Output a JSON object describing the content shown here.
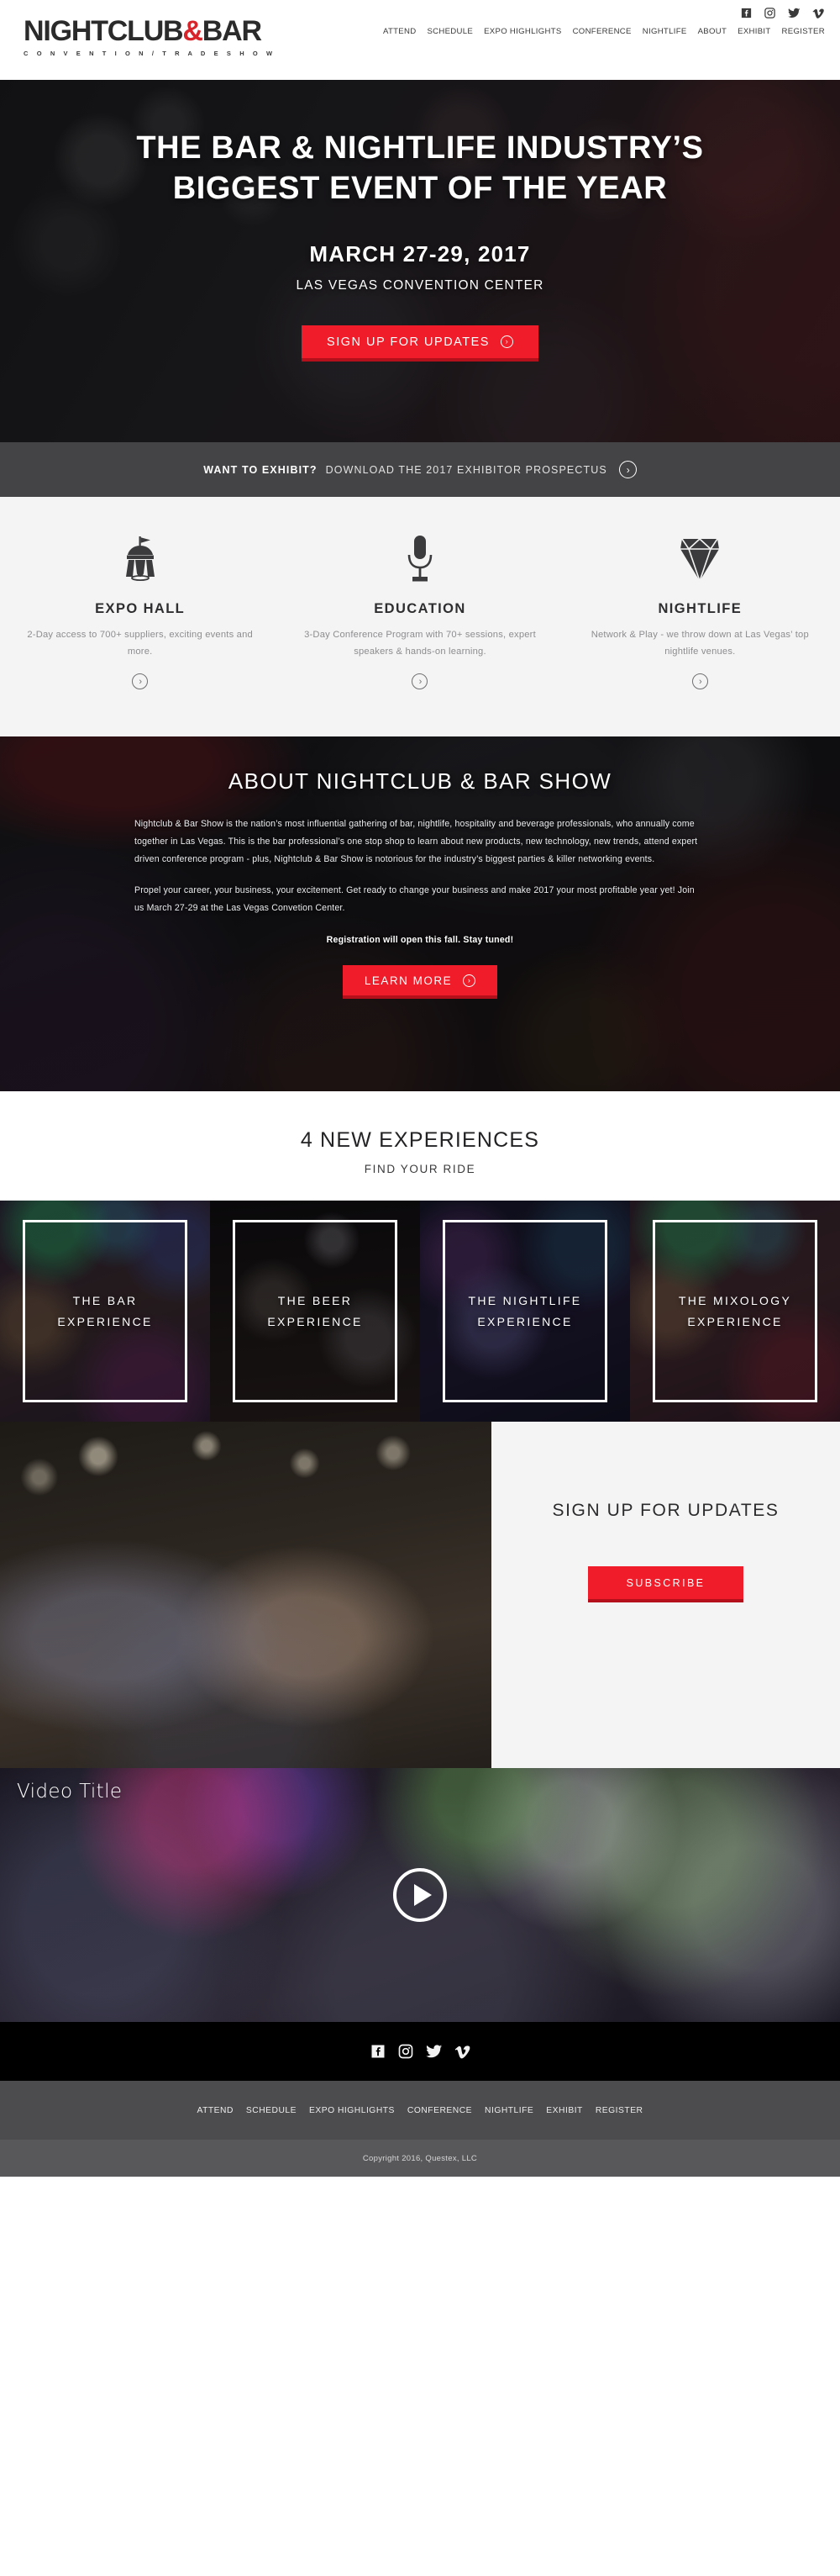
{
  "header": {
    "logo_main": "NIGHTCLUB",
    "logo_amp": "&",
    "logo_main2": "BAR",
    "logo_sub": "C O N V E N T I O N   /   T R A D E   S H O W",
    "social": [
      {
        "name": "facebook-icon",
        "label": "Facebook"
      },
      {
        "name": "instagram-icon",
        "label": "Instagram"
      },
      {
        "name": "twitter-icon",
        "label": "Twitter"
      },
      {
        "name": "vimeo-icon",
        "label": "Vimeo"
      }
    ],
    "nav": [
      {
        "label": "ATTEND"
      },
      {
        "label": "SCHEDULE"
      },
      {
        "label": "EXPO HIGHLIGHTS"
      },
      {
        "label": "CONFERENCE"
      },
      {
        "label": "NIGHTLIFE"
      },
      {
        "label": "ABOUT"
      },
      {
        "label": "EXHIBIT"
      },
      {
        "label": "REGISTER"
      }
    ]
  },
  "hero": {
    "title_line1": "THE BAR & NIGHTLIFE INDUSTRY’S",
    "title_line2": "BIGGEST EVENT OF THE YEAR",
    "date": "MARCH 27-29, 2017",
    "venue": "LAS VEGAS CONVENTION CENTER",
    "cta": "SIGN UP FOR UPDATES",
    "cta_arrow": "›",
    "accent_color": "#f01c29"
  },
  "exhibit_band": {
    "strong": "WANT TO EXHIBIT?",
    "rest": "DOWNLOAD THE 2017 EXHIBITOR PROSPECTUS",
    "arrow": "›",
    "bg_color": "#444446"
  },
  "features": [
    {
      "icon": "tent-icon",
      "title": "EXPO HALL",
      "desc": "2-Day access to 700+ suppliers, exciting events and more.",
      "arrow": "›"
    },
    {
      "icon": "microphone-icon",
      "title": "EDUCATION",
      "desc": "3-Day Conference Program with 70+ sessions, expert speakers & hands-on learning.",
      "arrow": "›"
    },
    {
      "icon": "diamond-icon",
      "title": "NIGHTLIFE",
      "desc": "Network & Play - we throw down at Las Vegas’ top nightlife venues.",
      "arrow": "›"
    }
  ],
  "about": {
    "title": "ABOUT NIGHTCLUB & BAR SHOW",
    "paragraph1": "Nightclub & Bar Show is the nation’s most influential gathering of bar, nightlife, hospitality and beverage professionals, who annually come together in Las Vegas. This is the bar professional’s one stop shop to learn about new products, new technology, new trends, attend expert driven conference program - plus, Nightclub & Bar Show is notorious for the industry’s biggest parties & killer networking events.",
    "paragraph2": "Propel your career, your business, your excitement. Get ready to change your business and make 2017 your most profitable year yet! Join us March 27-29 at the Las Vegas Convetion Center.",
    "note": "Registration will open this fall. Stay tuned!",
    "cta": "LEARN MORE",
    "cta_arrow": "›"
  },
  "experiences": {
    "title": "4 NEW EXPERIENCES",
    "subtitle": "FIND YOUR RIDE",
    "cards": [
      {
        "line1": "THE BAR",
        "line2": "EXPERIENCE"
      },
      {
        "line1": "THE BEER",
        "line2": "EXPERIENCE"
      },
      {
        "line1": "THE NIGHTLIFE",
        "line2": "EXPERIENCE"
      },
      {
        "line1": "THE MIXOLOGY",
        "line2": "EXPERIENCE"
      }
    ]
  },
  "signup": {
    "title": "SIGN UP FOR UPDATES",
    "button": "SUBSCRIBE"
  },
  "video": {
    "title": "Video Title",
    "play_label": "play-button"
  },
  "footer": {
    "social": [
      {
        "name": "facebook-icon",
        "label": "Facebook"
      },
      {
        "name": "instagram-icon",
        "label": "Instagram"
      },
      {
        "name": "twitter-icon",
        "label": "Twitter"
      },
      {
        "name": "vimeo-icon",
        "label": "Vimeo"
      }
    ],
    "nav": [
      {
        "label": "ATTEND"
      },
      {
        "label": "SCHEDULE"
      },
      {
        "label": "EXPO HIGHLIGHTS"
      },
      {
        "label": "CONFERENCE"
      },
      {
        "label": "NIGHTLIFE"
      },
      {
        "label": "EXHIBIT"
      },
      {
        "label": "REGISTER"
      }
    ],
    "copyright": "Copyright 2016, Questex, LLC"
  }
}
